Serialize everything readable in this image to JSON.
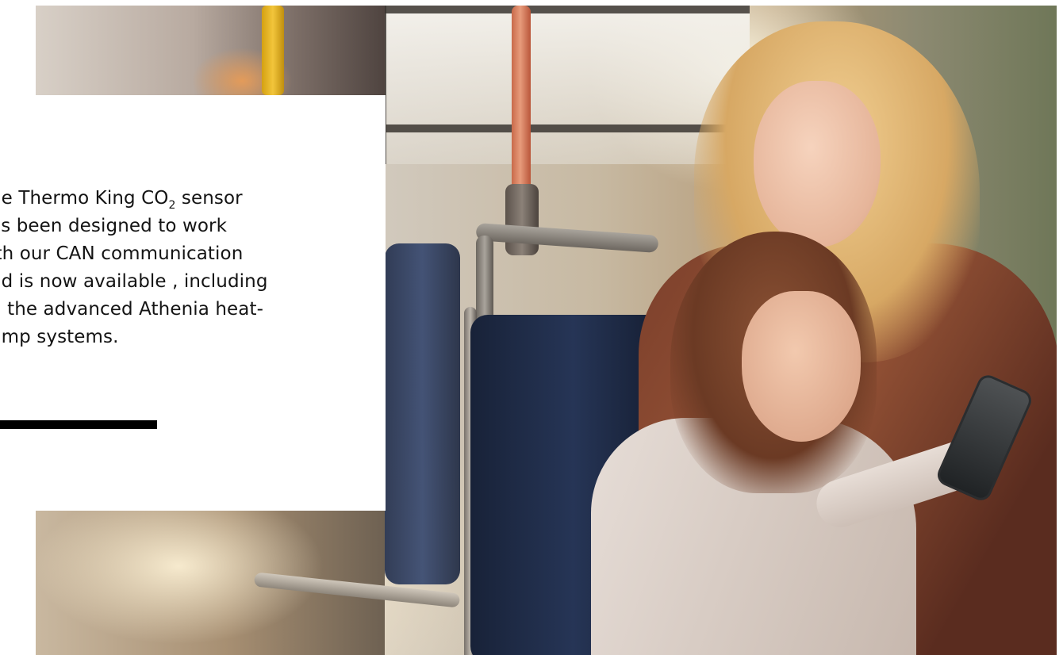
{
  "text_block": {
    "line1_before_sub": "he Thermo King CO",
    "line1_sub": "2",
    "line1_after_sub": " sensor",
    "line2": "as been designed to work",
    "line3": "ith our CAN communication",
    "line4": "nd is now available , including",
    "line5": "n the advanced Athenia heat-",
    "line6": "ump systems."
  },
  "colors": {
    "text": "#141414",
    "accent_bar": "#000000",
    "card_background": "#ffffff"
  }
}
